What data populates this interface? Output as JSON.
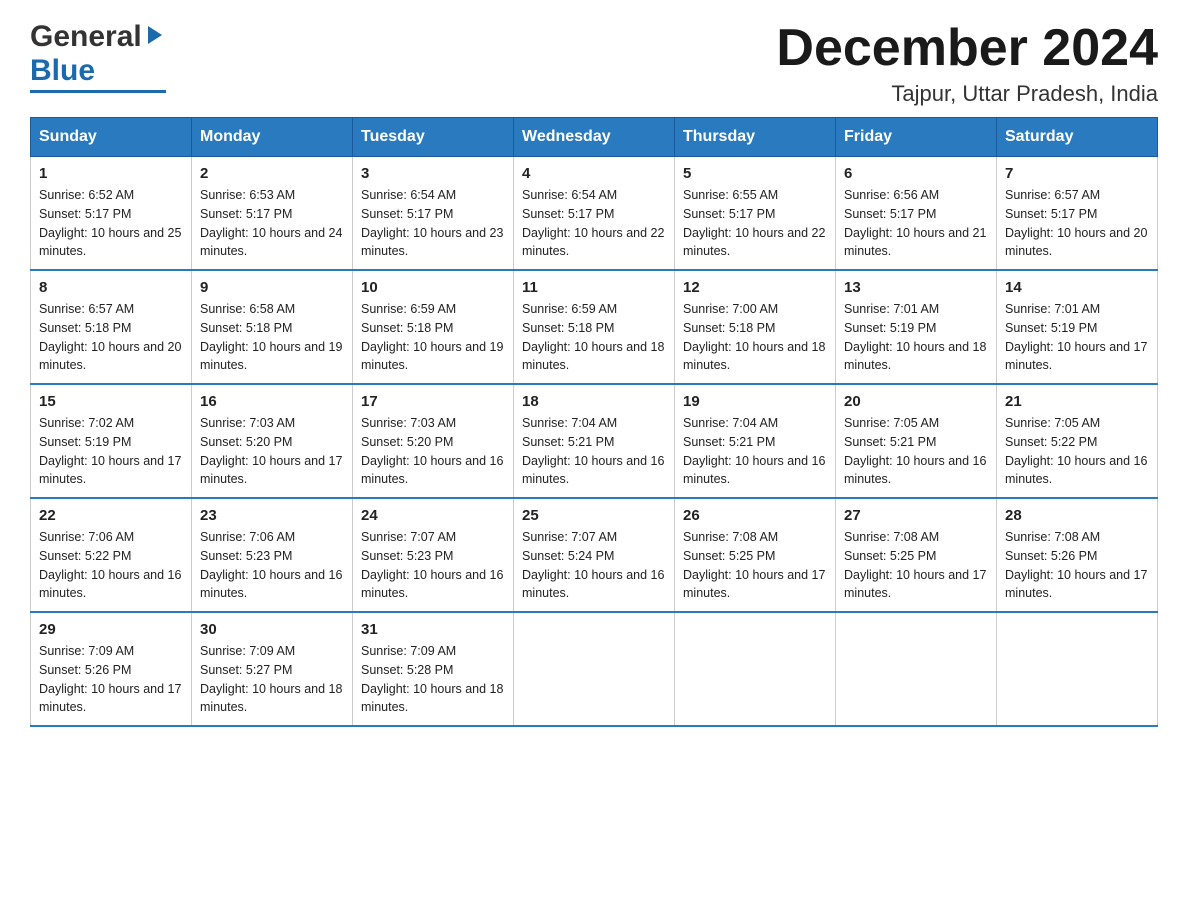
{
  "logo": {
    "general": "General",
    "arrow": "▶",
    "blue": "Blue"
  },
  "title": "December 2024",
  "location": "Tajpur, Uttar Pradesh, India",
  "days_of_week": [
    "Sunday",
    "Monday",
    "Tuesday",
    "Wednesday",
    "Thursday",
    "Friday",
    "Saturday"
  ],
  "weeks": [
    [
      {
        "day": "1",
        "sunrise": "6:52 AM",
        "sunset": "5:17 PM",
        "daylight": "10 hours and 25 minutes."
      },
      {
        "day": "2",
        "sunrise": "6:53 AM",
        "sunset": "5:17 PM",
        "daylight": "10 hours and 24 minutes."
      },
      {
        "day": "3",
        "sunrise": "6:54 AM",
        "sunset": "5:17 PM",
        "daylight": "10 hours and 23 minutes."
      },
      {
        "day": "4",
        "sunrise": "6:54 AM",
        "sunset": "5:17 PM",
        "daylight": "10 hours and 22 minutes."
      },
      {
        "day": "5",
        "sunrise": "6:55 AM",
        "sunset": "5:17 PM",
        "daylight": "10 hours and 22 minutes."
      },
      {
        "day": "6",
        "sunrise": "6:56 AM",
        "sunset": "5:17 PM",
        "daylight": "10 hours and 21 minutes."
      },
      {
        "day": "7",
        "sunrise": "6:57 AM",
        "sunset": "5:17 PM",
        "daylight": "10 hours and 20 minutes."
      }
    ],
    [
      {
        "day": "8",
        "sunrise": "6:57 AM",
        "sunset": "5:18 PM",
        "daylight": "10 hours and 20 minutes."
      },
      {
        "day": "9",
        "sunrise": "6:58 AM",
        "sunset": "5:18 PM",
        "daylight": "10 hours and 19 minutes."
      },
      {
        "day": "10",
        "sunrise": "6:59 AM",
        "sunset": "5:18 PM",
        "daylight": "10 hours and 19 minutes."
      },
      {
        "day": "11",
        "sunrise": "6:59 AM",
        "sunset": "5:18 PM",
        "daylight": "10 hours and 18 minutes."
      },
      {
        "day": "12",
        "sunrise": "7:00 AM",
        "sunset": "5:18 PM",
        "daylight": "10 hours and 18 minutes."
      },
      {
        "day": "13",
        "sunrise": "7:01 AM",
        "sunset": "5:19 PM",
        "daylight": "10 hours and 18 minutes."
      },
      {
        "day": "14",
        "sunrise": "7:01 AM",
        "sunset": "5:19 PM",
        "daylight": "10 hours and 17 minutes."
      }
    ],
    [
      {
        "day": "15",
        "sunrise": "7:02 AM",
        "sunset": "5:19 PM",
        "daylight": "10 hours and 17 minutes."
      },
      {
        "day": "16",
        "sunrise": "7:03 AM",
        "sunset": "5:20 PM",
        "daylight": "10 hours and 17 minutes."
      },
      {
        "day": "17",
        "sunrise": "7:03 AM",
        "sunset": "5:20 PM",
        "daylight": "10 hours and 16 minutes."
      },
      {
        "day": "18",
        "sunrise": "7:04 AM",
        "sunset": "5:21 PM",
        "daylight": "10 hours and 16 minutes."
      },
      {
        "day": "19",
        "sunrise": "7:04 AM",
        "sunset": "5:21 PM",
        "daylight": "10 hours and 16 minutes."
      },
      {
        "day": "20",
        "sunrise": "7:05 AM",
        "sunset": "5:21 PM",
        "daylight": "10 hours and 16 minutes."
      },
      {
        "day": "21",
        "sunrise": "7:05 AM",
        "sunset": "5:22 PM",
        "daylight": "10 hours and 16 minutes."
      }
    ],
    [
      {
        "day": "22",
        "sunrise": "7:06 AM",
        "sunset": "5:22 PM",
        "daylight": "10 hours and 16 minutes."
      },
      {
        "day": "23",
        "sunrise": "7:06 AM",
        "sunset": "5:23 PM",
        "daylight": "10 hours and 16 minutes."
      },
      {
        "day": "24",
        "sunrise": "7:07 AM",
        "sunset": "5:23 PM",
        "daylight": "10 hours and 16 minutes."
      },
      {
        "day": "25",
        "sunrise": "7:07 AM",
        "sunset": "5:24 PM",
        "daylight": "10 hours and 16 minutes."
      },
      {
        "day": "26",
        "sunrise": "7:08 AM",
        "sunset": "5:25 PM",
        "daylight": "10 hours and 17 minutes."
      },
      {
        "day": "27",
        "sunrise": "7:08 AM",
        "sunset": "5:25 PM",
        "daylight": "10 hours and 17 minutes."
      },
      {
        "day": "28",
        "sunrise": "7:08 AM",
        "sunset": "5:26 PM",
        "daylight": "10 hours and 17 minutes."
      }
    ],
    [
      {
        "day": "29",
        "sunrise": "7:09 AM",
        "sunset": "5:26 PM",
        "daylight": "10 hours and 17 minutes."
      },
      {
        "day": "30",
        "sunrise": "7:09 AM",
        "sunset": "5:27 PM",
        "daylight": "10 hours and 18 minutes."
      },
      {
        "day": "31",
        "sunrise": "7:09 AM",
        "sunset": "5:28 PM",
        "daylight": "10 hours and 18 minutes."
      },
      null,
      null,
      null,
      null
    ]
  ]
}
